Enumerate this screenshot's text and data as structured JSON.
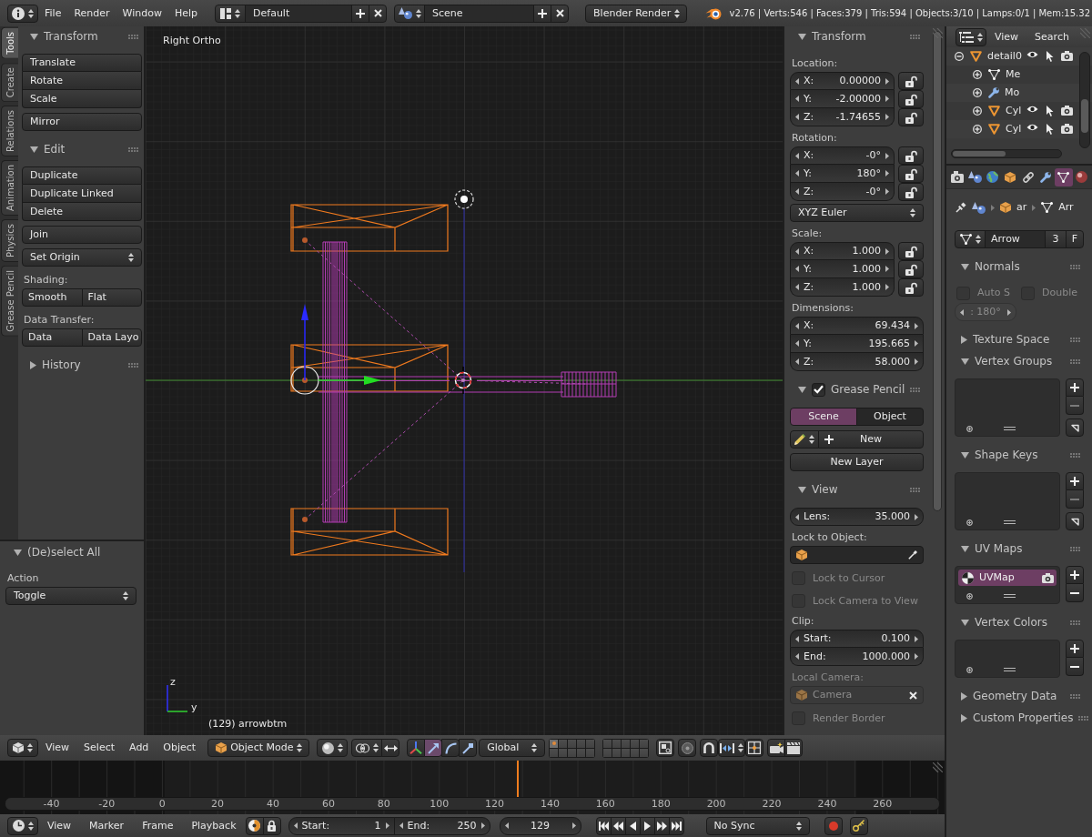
{
  "top_header": {
    "menus": [
      "File",
      "Render",
      "Window",
      "Help"
    ],
    "screen_layout": "Default",
    "scene": "Scene",
    "render_engine": "Blender Render",
    "stats": "v2.76 | Verts:546 | Faces:379 | Tris:594 | Objects:3/10 | Lamps:0/1 | Mem:15.32"
  },
  "tool_tabs": [
    {
      "label": "Tools",
      "selected": true
    },
    {
      "label": "Create",
      "selected": false
    },
    {
      "label": "Relations",
      "selected": false
    },
    {
      "label": "Animation",
      "selected": false
    },
    {
      "label": "Physics",
      "selected": false
    },
    {
      "label": "Grease Pencil",
      "selected": false
    }
  ],
  "tool_shelf": [
    {
      "title": "Transform",
      "expanded": true,
      "rows": [
        {
          "kind": "stack",
          "items": [
            "Translate",
            "Rotate",
            "Scale"
          ]
        },
        {
          "kind": "stack",
          "items": [
            "Mirror"
          ]
        }
      ]
    },
    {
      "title": "Edit",
      "expanded": true,
      "rows": [
        {
          "kind": "stack",
          "items": [
            "Duplicate",
            "Duplicate Linked",
            "Delete"
          ]
        },
        {
          "kind": "stack",
          "items": [
            "Join"
          ]
        },
        {
          "kind": "dropdown",
          "value": "Set Origin"
        },
        {
          "kind": "label",
          "text": "Shading:"
        },
        {
          "kind": "pair",
          "items": [
            "Smooth",
            "Flat"
          ]
        },
        {
          "kind": "label",
          "text": "Data Transfer:"
        },
        {
          "kind": "pair",
          "items": [
            "Data",
            "Data Layo"
          ]
        }
      ]
    },
    {
      "title": "History",
      "expanded": false
    }
  ],
  "operator_panel": {
    "title": "(De)select All",
    "expanded": true,
    "rows": [
      {
        "kind": "label",
        "text": "Action"
      },
      {
        "kind": "dropdown",
        "value": "Toggle"
      }
    ]
  },
  "viewport": {
    "view_name": "Right Ortho",
    "object_info": "(129) arrowbtm",
    "axis_labels": [
      "z",
      "y"
    ]
  },
  "n_panel": [
    {
      "title": "Transform",
      "expanded": true,
      "rows": [
        {
          "kind": "label",
          "text": "Location:",
          "disabled": false
        },
        {
          "kind": "vector",
          "fields": [
            {
              "label": "X:",
              "value": "0.00000",
              "locked": false
            },
            {
              "label": "Y:",
              "value": "-2.00000",
              "locked": false
            },
            {
              "label": "Z:",
              "value": "-1.74655",
              "locked": false
            }
          ]
        },
        {
          "kind": "label",
          "text": "Rotation:",
          "disabled": false
        },
        {
          "kind": "vector",
          "fields": [
            {
              "label": "X:",
              "value": "-0°",
              "locked": false
            },
            {
              "label": "Y:",
              "value": "180°",
              "locked": false
            },
            {
              "label": "Z:",
              "value": "-0°",
              "locked": false
            }
          ]
        },
        {
          "kind": "dropdown",
          "value": "XYZ Euler"
        },
        {
          "kind": "label",
          "text": "Scale:",
          "disabled": false
        },
        {
          "kind": "vector",
          "fields": [
            {
              "label": "X:",
              "value": "1.000",
              "locked": false
            },
            {
              "label": "Y:",
              "value": "1.000",
              "locked": false
            },
            {
              "label": "Z:",
              "value": "1.000",
              "locked": false
            }
          ]
        },
        {
          "kind": "label",
          "text": "Dimensions:",
          "disabled": false
        },
        {
          "kind": "vector",
          "fields": [
            {
              "label": "X:",
              "value": "69.434"
            },
            {
              "label": "Y:",
              "value": "195.665"
            },
            {
              "label": "Z:",
              "value": "58.000"
            }
          ]
        }
      ]
    },
    {
      "title": "Grease Pencil",
      "expanded": true,
      "checked": true,
      "rows": [
        {
          "kind": "tabs",
          "items": [
            {
              "label": "Scene",
              "selected": true
            },
            {
              "label": "Object",
              "selected": false
            }
          ]
        },
        {
          "kind": "new",
          "label": "New"
        },
        {
          "kind": "button",
          "label": "New Layer"
        }
      ]
    },
    {
      "title": "View",
      "expanded": true,
      "rows": [
        {
          "kind": "vector",
          "fields": [
            {
              "label": "Lens:",
              "value": "35.000"
            }
          ]
        },
        {
          "kind": "label",
          "text": "Lock to Object:",
          "disabled": false
        },
        {
          "kind": "object_field",
          "disabled": false
        },
        {
          "kind": "checkbox",
          "label": "Lock to Cursor",
          "checked": false,
          "disabled": true
        },
        {
          "kind": "checkbox",
          "label": "Lock Camera to View",
          "checked": false,
          "disabled": true
        },
        {
          "kind": "label",
          "text": "Clip:",
          "disabled": false
        },
        {
          "kind": "vector",
          "fields": [
            {
              "label": "Start:",
              "value": "0.100"
            },
            {
              "label": "End:",
              "value": "1000.000"
            }
          ]
        },
        {
          "kind": "label",
          "text": "Local Camera:",
          "disabled": true
        },
        {
          "kind": "object_field",
          "value": "Camera",
          "disabled": true
        },
        {
          "kind": "checkbox",
          "label": "Render Border",
          "checked": false,
          "disabled": true
        }
      ]
    }
  ],
  "outliner": {
    "menus": [
      "View",
      "Search"
    ],
    "tree": [
      {
        "name": "detail0",
        "kind": "object",
        "expanded": true,
        "children": [
          {
            "name": "Me",
            "kind": "mesh",
            "expanded": false
          },
          {
            "name": "Mo",
            "kind": "modifiers",
            "expanded": false
          },
          {
            "name": "Cyl",
            "kind": "object",
            "expanded": false
          },
          {
            "name": "Cyl",
            "kind": "object",
            "expanded": false
          }
        ]
      }
    ]
  },
  "properties": {
    "tabs": [
      {
        "kind": "render",
        "selected": false
      },
      {
        "kind": "scene",
        "selected": false
      },
      {
        "kind": "world",
        "selected": false
      },
      {
        "kind": "object",
        "selected": false
      },
      {
        "kind": "constraints",
        "selected": false
      },
      {
        "kind": "modifiers",
        "selected": false
      },
      {
        "kind": "data",
        "selected": true
      },
      {
        "kind": "material",
        "selected": false
      }
    ],
    "breadcrumb": [
      "ar",
      "Arr"
    ],
    "datablock": {
      "name": "Arrow",
      "users": "3",
      "fake_user": "F"
    },
    "panels": [
      {
        "title": "Normals",
        "expanded": true,
        "rows": [
          {
            "kind": "checkboxes",
            "items": [
              {
                "label": "Auto S",
                "checked": false,
                "disabled": true
              },
              {
                "label": "Double",
                "checked": false,
                "disabled": true
              }
            ]
          },
          {
            "kind": "number",
            "value": ": 180°",
            "disabled": true
          }
        ]
      },
      {
        "title": "Texture Space",
        "expanded": false
      },
      {
        "title": "Vertex Groups",
        "expanded": true,
        "rows": [
          {
            "kind": "list",
            "buttons": [
              {
                "kind": "add",
                "disabled": false
              },
              {
                "kind": "remove",
                "disabled": true
              },
              {
                "kind": "specials",
                "disabled": false
              }
            ]
          }
        ]
      },
      {
        "title": "Shape Keys",
        "expanded": true,
        "rows": [
          {
            "kind": "list",
            "buttons": [
              {
                "kind": "add",
                "disabled": false
              },
              {
                "kind": "remove",
                "disabled": true
              },
              {
                "kind": "specials",
                "disabled": false
              }
            ]
          }
        ]
      },
      {
        "title": "UV Maps",
        "expanded": true,
        "rows": [
          {
            "kind": "list",
            "items": [
              {
                "name": "UVMap",
                "selected": true
              }
            ],
            "buttons": [
              {
                "kind": "add",
                "disabled": false
              },
              {
                "kind": "remove",
                "disabled": false
              }
            ]
          }
        ]
      },
      {
        "title": "Vertex Colors",
        "expanded": true,
        "rows": [
          {
            "kind": "list",
            "buttons": [
              {
                "kind": "add",
                "disabled": false
              },
              {
                "kind": "remove",
                "disabled": false
              }
            ]
          }
        ]
      },
      {
        "title": "Geometry Data",
        "expanded": false
      },
      {
        "title": "Custom Properties",
        "expanded": false
      }
    ]
  },
  "view3d_header": {
    "menus": [
      "View",
      "Select",
      "Add",
      "Object"
    ],
    "mode": "Object Mode",
    "manipulators": [
      {
        "kind": "toggle",
        "selected": false
      },
      {
        "kind": "translate",
        "selected": true
      },
      {
        "kind": "rotate",
        "selected": false
      },
      {
        "kind": "scale",
        "selected": false
      }
    ],
    "orientation": "Global",
    "layers": [
      {
        "selected": true,
        "used": true
      },
      {
        "selected": false,
        "used": false
      },
      {
        "selected": false,
        "used": false
      },
      {
        "selected": false,
        "used": false
      },
      {
        "selected": false,
        "used": false
      },
      {
        "selected": false,
        "used": false
      },
      {
        "selected": false,
        "used": false
      },
      {
        "selected": false,
        "used": false
      },
      {
        "selected": false,
        "used": false
      },
      {
        "selected": false,
        "used": false
      },
      {
        "selected": false,
        "used": false
      },
      {
        "selected": false,
        "used": false
      },
      {
        "selected": false,
        "used": false
      },
      {
        "selected": false,
        "used": false
      },
      {
        "selected": false,
        "used": false
      },
      {
        "selected": false,
        "used": false
      },
      {
        "selected": false,
        "used": false
      },
      {
        "selected": false,
        "used": false
      },
      {
        "selected": false,
        "used": false
      },
      {
        "selected": false,
        "used": false
      }
    ]
  },
  "timeline": {
    "ruler": [
      "-40",
      "-20",
      "0",
      "20",
      "40",
      "60",
      "80",
      "100",
      "120",
      "140",
      "160",
      "180",
      "200",
      "220",
      "240",
      "260"
    ],
    "playhead": {
      "level": 0.548
    },
    "menus": [
      "View",
      "Marker",
      "Frame",
      "Playback"
    ],
    "start": {
      "label": "Start:",
      "value": "1"
    },
    "end": {
      "label": "End:",
      "value": "250"
    },
    "current_frame": "129",
    "sync": "No Sync"
  }
}
